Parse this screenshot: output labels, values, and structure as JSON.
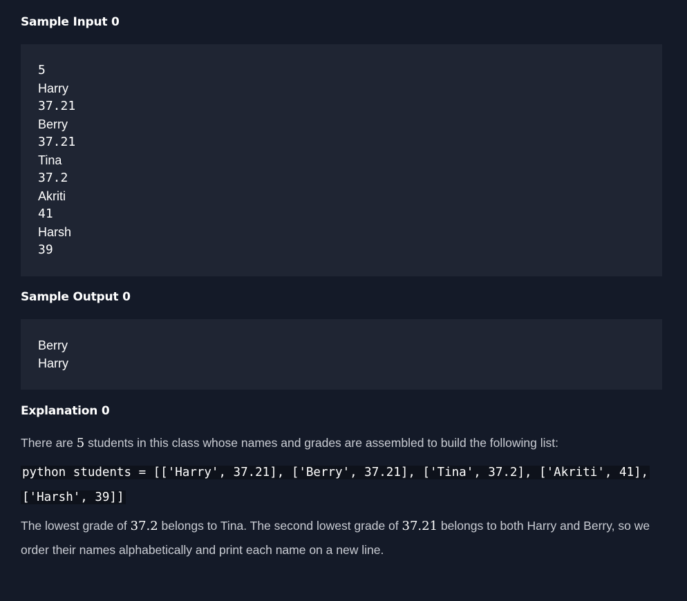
{
  "sample_input": {
    "heading": "Sample Input 0",
    "lines": [
      "5",
      "Harry",
      "37.21",
      "Berry",
      "37.21",
      "Tina",
      "37.2",
      "Akriti",
      "41",
      "Harsh",
      "39"
    ]
  },
  "sample_output": {
    "heading": "Sample Output 0",
    "lines": [
      "Berry",
      "Harry"
    ]
  },
  "explanation": {
    "heading": "Explanation 0",
    "intro_before": "There are",
    "intro_count": "5",
    "intro_after": "students in this class whose names and grades are assembled to build the following list:",
    "code_line_1": "python students = [['Harry', 37.21], ['Berry', 37.21], ['Tina', 37.2], ['Akriti', 41],",
    "code_line_2": "['Harsh', 39]]",
    "p2_a": "The lowest grade of",
    "p2_math1": "37.2",
    "p2_b": "belongs to Tina. The second lowest grade of",
    "p2_math2": "37.21",
    "p2_c": "belongs to both Harry and Berry, so we",
    "p2_line2": "order their names alphabetically and print each name on a new line."
  }
}
